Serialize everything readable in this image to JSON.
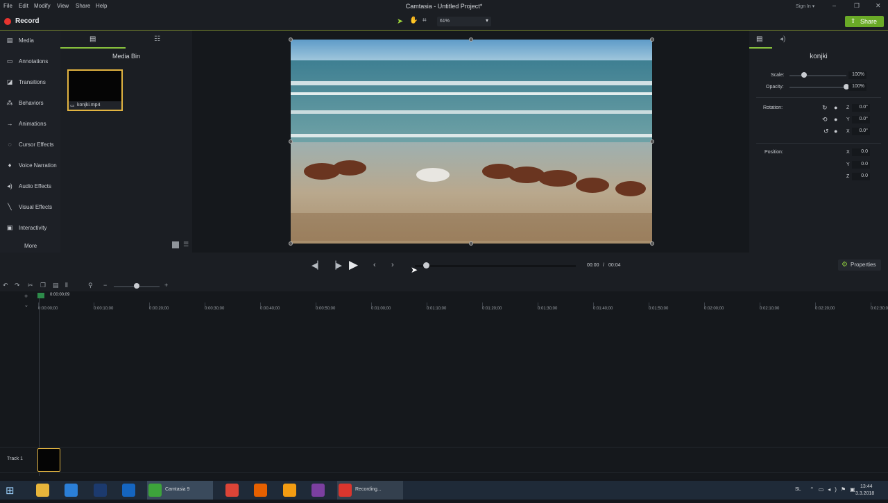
{
  "menu": [
    "File",
    "Edit",
    "Modify",
    "View",
    "Share",
    "Help"
  ],
  "window_title": "Camtasia - Untitled Project*",
  "sign_in": "Sign In",
  "toolbar": {
    "record_label": "Record",
    "zoom": "61%",
    "share_label": "Share"
  },
  "left_nav": {
    "items": [
      {
        "label": "Media",
        "icon": "film-icon"
      },
      {
        "label": "Annotations",
        "icon": "annotation-icon"
      },
      {
        "label": "Transitions",
        "icon": "transition-icon"
      },
      {
        "label": "Behaviors",
        "icon": "behavior-icon"
      },
      {
        "label": "Animations",
        "icon": "animation-icon"
      },
      {
        "label": "Cursor Effects",
        "icon": "cursor-icon"
      },
      {
        "label": "Voice Narration",
        "icon": "microphone-icon"
      },
      {
        "label": "Audio Effects",
        "icon": "speaker-icon"
      },
      {
        "label": "Visual Effects",
        "icon": "wand-icon"
      },
      {
        "label": "Interactivity",
        "icon": "interactive-icon"
      }
    ],
    "more_label": "More"
  },
  "media_bin": {
    "title": "Media Bin",
    "clip_name": "konjki.mp4"
  },
  "properties": {
    "title": "konjki",
    "scale_label": "Scale:",
    "scale_value": "100%",
    "scale_level": 0.25,
    "opacity_label": "Opacity:",
    "opacity_value": "100%",
    "opacity_level": 1.0,
    "rotation_label": "Rotation:",
    "rotation": [
      {
        "axis": "Z",
        "value": "0.0°"
      },
      {
        "axis": "Y",
        "value": "0.0°"
      },
      {
        "axis": "X",
        "value": "0.0°"
      }
    ],
    "position_label": "Position:",
    "position": [
      {
        "axis": "X",
        "value": "0.0"
      },
      {
        "axis": "Y",
        "value": "0.0"
      },
      {
        "axis": "Z",
        "value": "0.0"
      }
    ],
    "button_label": "Properties"
  },
  "playback": {
    "current_time": "00:00",
    "separator": "/",
    "total_time": "00:04",
    "progress": 0.0
  },
  "timeline": {
    "playhead_time": "0:00:00;09",
    "ticks": [
      "0:00:00;00",
      "0:00:10;00",
      "0:00:20;00",
      "0:00:30;00",
      "0:00:40;00",
      "0:00:50;00",
      "0:01:00;00",
      "0:01:10;00",
      "0:01:20;00",
      "0:01:30;00",
      "0:01:40;00",
      "0:01:50;00",
      "0:02:00;00",
      "0:02:10;00",
      "0:02:20;00",
      "0:02:30;00"
    ],
    "track_name": "Track 1"
  },
  "taskbar": {
    "items": [
      {
        "label": "",
        "icon": "file-explorer-icon",
        "color": "#e8b53b"
      },
      {
        "label": "",
        "icon": "internet-explorer-icon",
        "color": "#2b7fd8"
      },
      {
        "label": "",
        "icon": "hp-icon",
        "color": "#1c3a6e"
      },
      {
        "label": "",
        "icon": "outlook-icon",
        "color": "#1565c0"
      },
      {
        "label": "Camtasia 9",
        "icon": "camtasia-icon",
        "color": "#3da33b"
      },
      {
        "label": "",
        "icon": "chrome-icon",
        "color": "#db4437"
      },
      {
        "label": "",
        "icon": "firefox-icon",
        "color": "#e66000"
      },
      {
        "label": "",
        "icon": "app-orange-icon",
        "color": "#f39c12"
      },
      {
        "label": "",
        "icon": "app-purple-icon",
        "color": "#7b3fa0"
      },
      {
        "label": "Recording...",
        "icon": "recorder-icon",
        "color": "#d9362e"
      }
    ],
    "language": "SL",
    "clock_time": "13:44",
    "clock_date": "3.3.2018"
  },
  "colors": {
    "accent": "#8ac53e",
    "record": "#e8342f",
    "share": "#6aaa27",
    "selection": "#e2b441"
  }
}
